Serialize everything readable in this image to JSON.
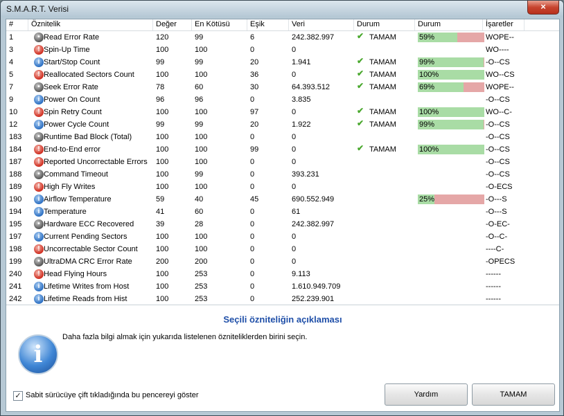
{
  "window": {
    "title": "S.M.A.R.T. Verisi",
    "close_glyph": "×"
  },
  "columns": [
    "#",
    "Öznitelik",
    "Değer",
    "En Kötüsü",
    "Eşik",
    "Veri",
    "Durum",
    "Durum",
    "İşaretler"
  ],
  "rows": [
    {
      "id": "1",
      "icon": "dark",
      "name": "Read Error Rate",
      "value": "120",
      "worst": "99",
      "threshold": "6",
      "raw": "242.382.997",
      "status": "TAMAM",
      "pct": 0.59,
      "pct_label": "59%",
      "flags": "WOPE--"
    },
    {
      "id": "3",
      "icon": "warn",
      "name": "Spin-Up Time",
      "value": "100",
      "worst": "100",
      "threshold": "0",
      "raw": "0",
      "status": "",
      "pct": null,
      "pct_label": "",
      "flags": "WO----"
    },
    {
      "id": "4",
      "icon": "info",
      "name": "Start/Stop Count",
      "value": "99",
      "worst": "99",
      "threshold": "20",
      "raw": "1.941",
      "status": "TAMAM",
      "pct": 0.99,
      "pct_label": "99%",
      "flags": "-O--CS"
    },
    {
      "id": "5",
      "icon": "warn",
      "name": "Reallocated Sectors Count",
      "value": "100",
      "worst": "100",
      "threshold": "36",
      "raw": "0",
      "status": "TAMAM",
      "pct": 1.0,
      "pct_label": "100%",
      "flags": "WO--CS"
    },
    {
      "id": "7",
      "icon": "dark",
      "name": "Seek Error Rate",
      "value": "78",
      "worst": "60",
      "threshold": "30",
      "raw": "64.393.512",
      "status": "TAMAM",
      "pct": 0.69,
      "pct_label": "69%",
      "flags": "WOPE--"
    },
    {
      "id": "9",
      "icon": "info",
      "name": "Power On Count",
      "value": "96",
      "worst": "96",
      "threshold": "0",
      "raw": "3.835",
      "status": "",
      "pct": null,
      "pct_label": "",
      "flags": "-O--CS"
    },
    {
      "id": "10",
      "icon": "warn",
      "name": "Spin Retry Count",
      "value": "100",
      "worst": "100",
      "threshold": "97",
      "raw": "0",
      "status": "TAMAM",
      "pct": 1.0,
      "pct_label": "100%",
      "flags": "WO--C-"
    },
    {
      "id": "12",
      "icon": "info",
      "name": "Power Cycle Count",
      "value": "99",
      "worst": "99",
      "threshold": "20",
      "raw": "1.922",
      "status": "TAMAM",
      "pct": 0.99,
      "pct_label": "99%",
      "flags": "-O--CS"
    },
    {
      "id": "183",
      "icon": "dark",
      "name": "Runtime Bad Block (Total)",
      "value": "100",
      "worst": "100",
      "threshold": "0",
      "raw": "0",
      "status": "",
      "pct": null,
      "pct_label": "",
      "flags": "-O--CS"
    },
    {
      "id": "184",
      "icon": "warn",
      "name": "End-to-End error",
      "value": "100",
      "worst": "100",
      "threshold": "99",
      "raw": "0",
      "status": "TAMAM",
      "pct": 1.0,
      "pct_label": "100%",
      "flags": "-O--CS"
    },
    {
      "id": "187",
      "icon": "warn",
      "name": "Reported Uncorrectable Errors",
      "value": "100",
      "worst": "100",
      "threshold": "0",
      "raw": "0",
      "status": "",
      "pct": null,
      "pct_label": "",
      "flags": "-O--CS"
    },
    {
      "id": "188",
      "icon": "dark",
      "name": "Command Timeout",
      "value": "100",
      "worst": "99",
      "threshold": "0",
      "raw": "393.231",
      "status": "",
      "pct": null,
      "pct_label": "",
      "flags": "-O--CS"
    },
    {
      "id": "189",
      "icon": "warn",
      "name": "High Fly Writes",
      "value": "100",
      "worst": "100",
      "threshold": "0",
      "raw": "0",
      "status": "",
      "pct": null,
      "pct_label": "",
      "flags": "-O-ECS"
    },
    {
      "id": "190",
      "icon": "info",
      "name": "Airflow Temperature",
      "value": "59",
      "worst": "40",
      "threshold": "45",
      "raw": "690.552.949",
      "status": "",
      "pct": 0.25,
      "pct_label": "25%",
      "flags": "-O---S"
    },
    {
      "id": "194",
      "icon": "info",
      "name": "Temperature",
      "value": "41",
      "worst": "60",
      "threshold": "0",
      "raw": "61",
      "status": "",
      "pct": null,
      "pct_label": "",
      "flags": "-O---S"
    },
    {
      "id": "195",
      "icon": "dark",
      "name": "Hardware ECC Recovered",
      "value": "39",
      "worst": "28",
      "threshold": "0",
      "raw": "242.382.997",
      "status": "",
      "pct": null,
      "pct_label": "",
      "flags": "-O-EC-"
    },
    {
      "id": "197",
      "icon": "info",
      "name": "Current Pending Sectors",
      "value": "100",
      "worst": "100",
      "threshold": "0",
      "raw": "0",
      "status": "",
      "pct": null,
      "pct_label": "",
      "flags": "-O--C-"
    },
    {
      "id": "198",
      "icon": "warn",
      "name": "Uncorrectable Sector Count",
      "value": "100",
      "worst": "100",
      "threshold": "0",
      "raw": "0",
      "status": "",
      "pct": null,
      "pct_label": "",
      "flags": "----C-"
    },
    {
      "id": "199",
      "icon": "dark",
      "name": "UltraDMA CRC Error Rate",
      "value": "200",
      "worst": "200",
      "threshold": "0",
      "raw": "0",
      "status": "",
      "pct": null,
      "pct_label": "",
      "flags": "-OPECS"
    },
    {
      "id": "240",
      "icon": "warn",
      "name": "Head Flying Hours",
      "value": "100",
      "worst": "253",
      "threshold": "0",
      "raw": "9.113",
      "status": "",
      "pct": null,
      "pct_label": "",
      "flags": "------"
    },
    {
      "id": "241",
      "icon": "info",
      "name": "Lifetime Writes from Host",
      "value": "100",
      "worst": "253",
      "threshold": "0",
      "raw": "1.610.949.709",
      "status": "",
      "pct": null,
      "pct_label": "",
      "flags": "------"
    },
    {
      "id": "242",
      "icon": "info",
      "name": "Lifetime Reads from Hist",
      "value": "100",
      "worst": "253",
      "threshold": "0",
      "raw": "252.239.901",
      "status": "",
      "pct": null,
      "pct_label": "",
      "flags": "------"
    }
  ],
  "description": {
    "title": "Seçili özniteliğin açıklaması",
    "text": "Daha fazla bilgi almak için yukarıda listelenen özniteliklerden birini seçin.",
    "icon_glyph": "i"
  },
  "checkbox": {
    "label": "Sabit sürücüye çift tıkladığında bu pencereyi göster",
    "checked": true,
    "mark": "✓"
  },
  "buttons": {
    "help": "Yardım",
    "ok": "TAMAM"
  },
  "colors": {
    "bar_fill": "#a9dca5",
    "bar_empty": "#e5a7a7",
    "check": "#4aa82e",
    "desc_title": "#1f4fa8"
  }
}
